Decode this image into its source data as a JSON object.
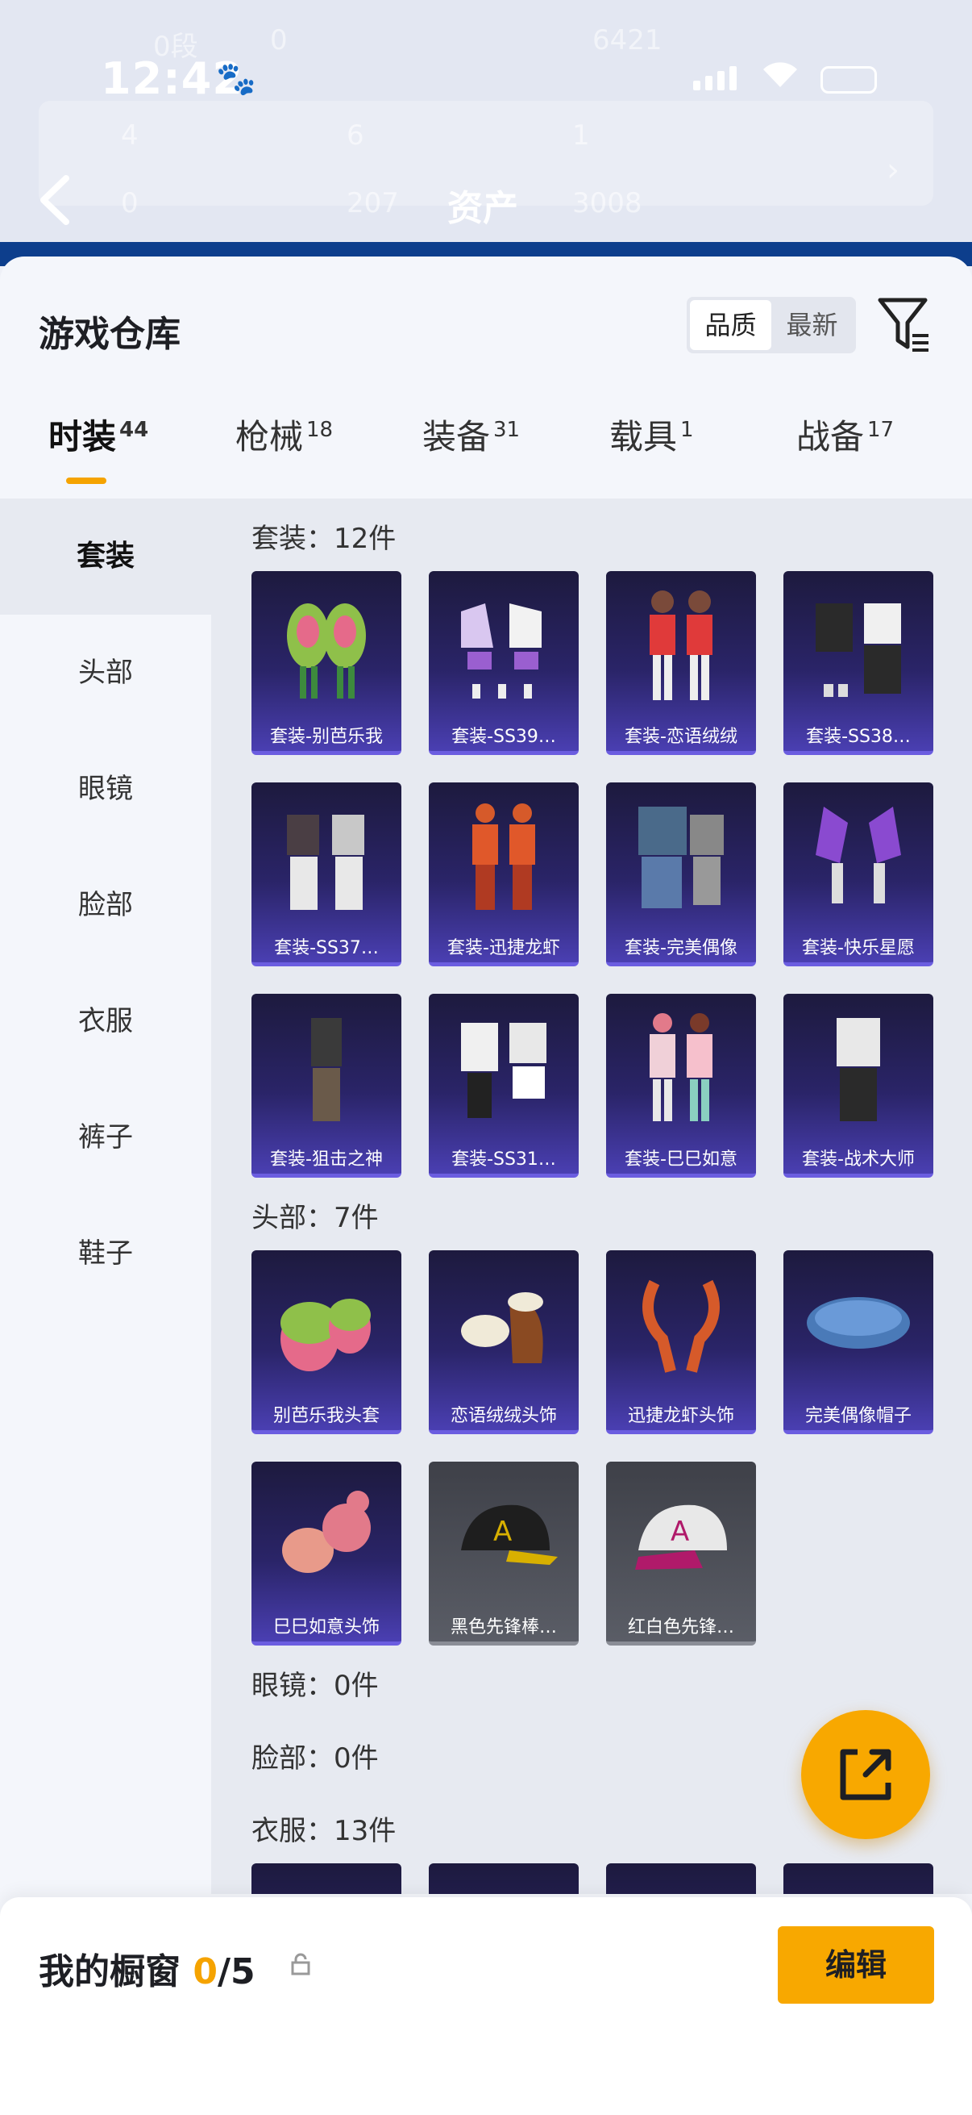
{
  "status_bar": {
    "time": "12:42",
    "paw": "🐾"
  },
  "header": {
    "asset_title": "资产",
    "ghost_texts": [
      "0段",
      "0",
      "6421",
      "4",
      "6",
      "1",
      "0",
      "207",
      "3008"
    ]
  },
  "sheet": {
    "title": "游戏仓库",
    "sort_options": [
      "品质",
      "最新"
    ],
    "sort_selected": "品质"
  },
  "tabs": [
    {
      "label": "时装",
      "count": "44"
    },
    {
      "label": "枪械",
      "count": "18"
    },
    {
      "label": "装备",
      "count": "31"
    },
    {
      "label": "载具",
      "count": "1"
    },
    {
      "label": "战备",
      "count": "17"
    }
  ],
  "categories": [
    "套装",
    "头部",
    "眼镜",
    "脸部",
    "衣服",
    "裤子",
    "鞋子"
  ],
  "sections": {
    "suits": {
      "heading": "套装：12件",
      "items": [
        "套装-别芭乐我",
        "套装-SS39…",
        "套装-恋语绒绒",
        "套装-SS38…",
        "套装-SS37…",
        "套装-迅捷龙虾",
        "套装-完美偶像",
        "套装-快乐星愿",
        "套装-狙击之神",
        "套装-SS31…",
        "套装-巳巳如意",
        "套装-战术大师"
      ]
    },
    "head": {
      "heading": "头部：7件",
      "items": [
        "别芭乐我头套",
        "恋语绒绒头饰",
        "迅捷龙虾头饰",
        "完美偶像帽子",
        "巳巳如意头饰",
        "黑色先锋棒…",
        "红白色先锋…"
      ]
    },
    "glasses": {
      "heading": "眼镜：0件"
    },
    "face": {
      "heading": "脸部：0件"
    },
    "clothes": {
      "heading": "衣服：13件"
    }
  },
  "bottom_bar": {
    "title": "我的橱窗",
    "count_current": "0",
    "count_total": "/5",
    "edit_label": "编辑"
  },
  "colors": {
    "accent": "#f8a800",
    "item_bg": "#2a2468",
    "item_border": "#6b5de0"
  }
}
